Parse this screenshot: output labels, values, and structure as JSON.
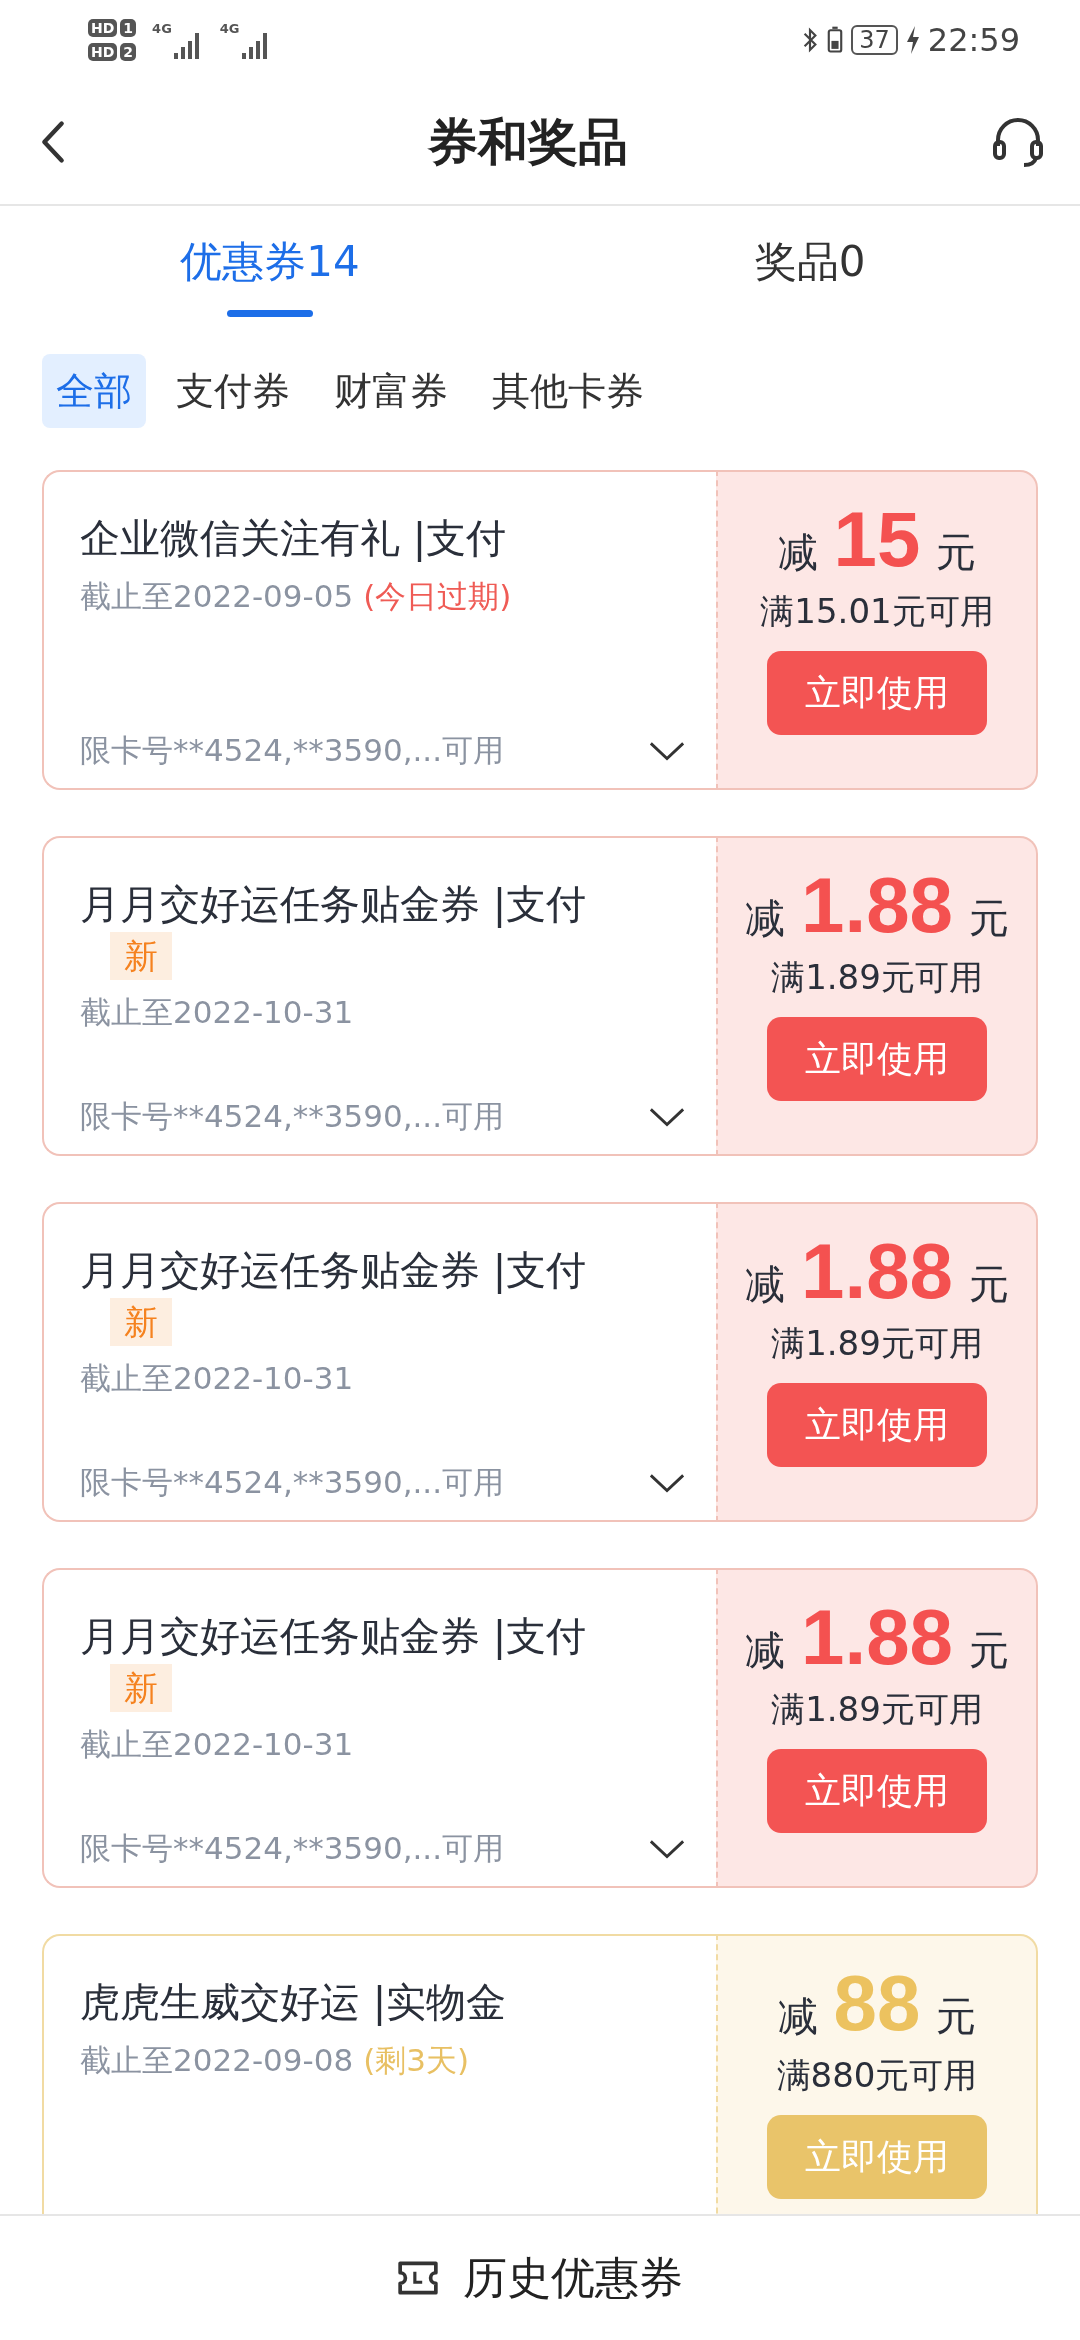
{
  "status_bar": {
    "sims": [
      {
        "hd": "HD",
        "slot": "1"
      },
      {
        "hd": "HD",
        "slot": "2"
      }
    ],
    "networks": [
      "4G",
      "4G"
    ],
    "battery": "37",
    "time": "22:59"
  },
  "header": {
    "title": "券和奖品"
  },
  "tabs": [
    {
      "label": "优惠券14",
      "selected": true
    },
    {
      "label": "奖品0",
      "selected": false
    }
  ],
  "filters": [
    {
      "label": "全部",
      "selected": true
    },
    {
      "label": "支付券",
      "selected": false
    },
    {
      "label": "财富券",
      "selected": false
    },
    {
      "label": "其他卡券",
      "selected": false
    }
  ],
  "coupons": [
    {
      "kind": "pay",
      "title": "企业微信关注有礼 |支付",
      "deadline": "截止至2022-09-05",
      "note": "(今日过期)",
      "cards": "限卡号**4524,**3590,...可用",
      "prefix": "减",
      "amount": "15",
      "unit": "元",
      "condition": "满15.01元可用",
      "button": "立即使用"
    },
    {
      "kind": "pay",
      "title": "月月交好运任务贴金券 |支付",
      "tag": "新",
      "deadline": "截止至2022-10-31",
      "cards": "限卡号**4524,**3590,...可用",
      "prefix": "减",
      "amount": "1.88",
      "unit": "元",
      "condition": "满1.89元可用",
      "button": "立即使用"
    },
    {
      "kind": "pay",
      "title": "月月交好运任务贴金券 |支付",
      "tag": "新",
      "deadline": "截止至2022-10-31",
      "cards": "限卡号**4524,**3590,...可用",
      "prefix": "减",
      "amount": "1.88",
      "unit": "元",
      "condition": "满1.89元可用",
      "button": "立即使用"
    },
    {
      "kind": "pay",
      "title": "月月交好运任务贴金券 |支付",
      "tag": "新",
      "deadline": "截止至2022-10-31",
      "cards": "限卡号**4524,**3590,...可用",
      "prefix": "减",
      "amount": "1.88",
      "unit": "元",
      "condition": "满1.89元可用",
      "button": "立即使用"
    },
    {
      "kind": "gold",
      "title": "虎虎生威交好运 |实物金",
      "deadline": "截止至2022-09-08",
      "note": "(剩3天)",
      "prefix": "减",
      "amount": "88",
      "unit": "元",
      "condition": "满880元可用",
      "button": "立即使用"
    }
  ],
  "footer": {
    "label": "历史优惠券"
  }
}
